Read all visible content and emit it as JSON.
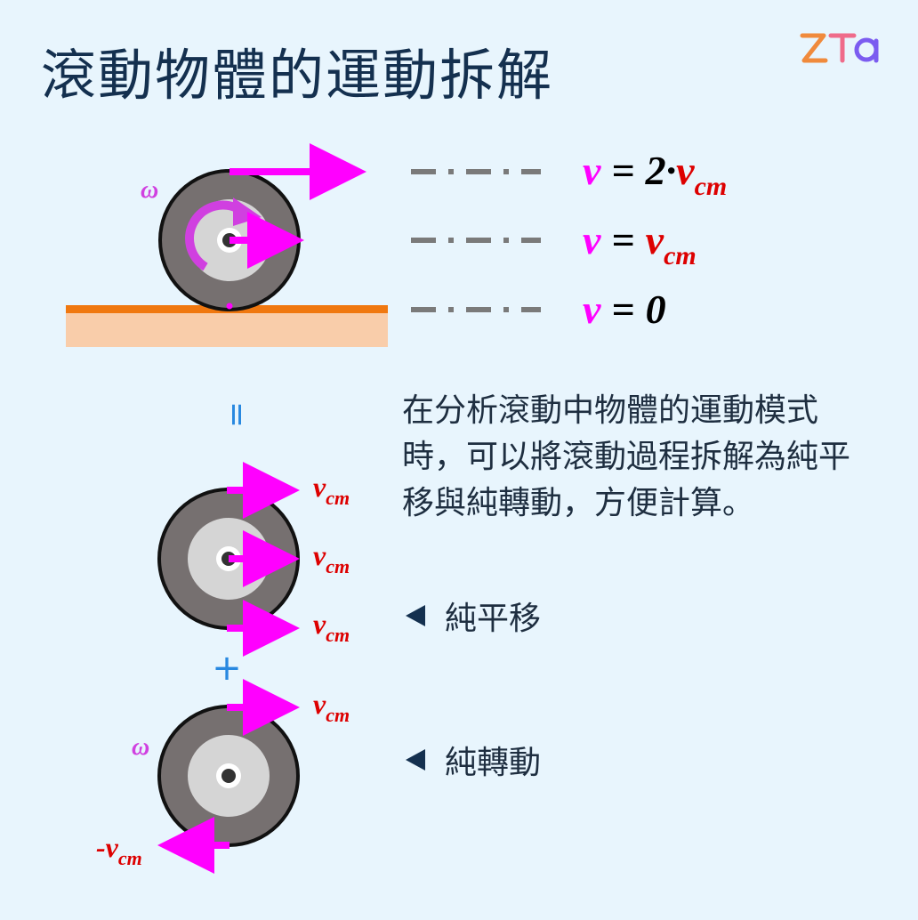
{
  "title": "滾動物體的運動拆解",
  "logo": {
    "text": "ZTa",
    "colors": [
      "#f08a3c",
      "#ef6b8a",
      "#7b5cf0"
    ]
  },
  "colors": {
    "background": "#e8f5fd",
    "arrow": "#ff00ff",
    "omega": "#d040e0",
    "cm_red": "#dd0000",
    "ground_line": "#f07810",
    "ground_fill": "#f9cdaa",
    "wheel_outer": "#767070",
    "wheel_inner": "#d5d5d5",
    "accent_blue": "#2888e0",
    "dashed": "#7a7a7a"
  },
  "top_wheel": {
    "omega": "ω",
    "formulas": [
      {
        "v": "v",
        "eq": "=",
        "mid": "2·",
        "rest": "v",
        "sub": "cm"
      },
      {
        "v": "v",
        "eq": "=",
        "mid": "",
        "rest": "v",
        "sub": "cm"
      },
      {
        "v": "v",
        "eq": "=",
        "mid": "0",
        "rest": "",
        "sub": ""
      }
    ]
  },
  "equals_sign": "=",
  "plus_sign": "+",
  "description": "在分析滾動中物體的運動模式時，可以將滾動過程拆解為純平移與純轉動，方便計算。",
  "translation_wheel": {
    "labels": [
      {
        "v": "v",
        "sub": "cm"
      },
      {
        "v": "v",
        "sub": "cm"
      },
      {
        "v": "v",
        "sub": "cm"
      }
    ],
    "caption": "純平移"
  },
  "rotation_wheel": {
    "omega": "ω",
    "top_label": {
      "v": "v",
      "sub": "cm"
    },
    "bottom_label": {
      "prefix": "-",
      "v": "v",
      "sub": "cm"
    },
    "caption": "純轉動"
  }
}
